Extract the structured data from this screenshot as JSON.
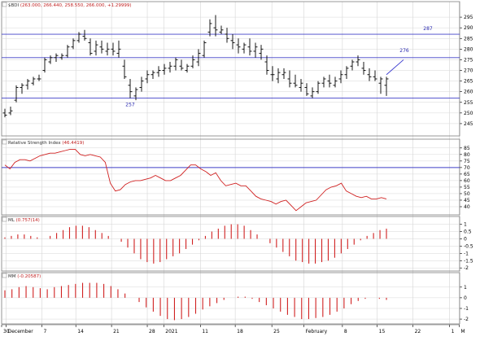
{
  "chart_data": {
    "type": "stock",
    "panels": [
      {
        "id": "price",
        "title_prefix": "$BDI",
        "title_values": "(263.000, 266.440, 258.550, 266.000, +1.29999)",
        "ylim": [
          240,
          300
        ],
        "yticks": [
          245,
          250,
          255,
          260,
          265,
          270,
          275,
          280,
          285,
          290,
          295
        ],
        "hlines": [
          {
            "value": 287,
            "label": "287"
          },
          {
            "value": 276,
            "label": "276"
          },
          {
            "value": 257,
            "label": "257"
          }
        ],
        "trendline": {
          "from": [
            67,
            268
          ],
          "to": [
            70,
            275
          ]
        },
        "ohlc": [
          [
            0,
            250,
            252,
            248,
            249
          ],
          [
            1,
            250,
            253,
            249,
            251
          ],
          [
            2,
            256,
            263,
            255,
            262
          ],
          [
            3,
            262,
            264,
            259,
            263
          ],
          [
            4,
            263,
            266,
            261,
            265
          ],
          [
            5,
            264,
            267,
            263,
            266
          ],
          [
            6,
            266,
            268,
            265,
            266
          ],
          [
            7,
            270,
            276,
            269,
            275
          ],
          [
            8,
            274,
            277,
            273,
            276
          ],
          [
            9,
            276,
            278,
            274,
            277
          ],
          [
            10,
            276,
            278,
            275,
            277
          ],
          [
            11,
            277,
            282,
            276,
            281
          ],
          [
            12,
            281,
            285,
            280,
            284
          ],
          [
            13,
            284,
            288,
            283,
            287
          ],
          [
            14,
            286,
            289,
            284,
            285
          ],
          [
            15,
            283,
            285,
            277,
            278
          ],
          [
            16,
            279,
            284,
            277,
            282
          ],
          [
            17,
            281,
            284,
            278,
            280
          ],
          [
            18,
            279,
            283,
            277,
            280
          ],
          [
            19,
            280,
            283,
            277,
            279
          ],
          [
            20,
            278,
            284,
            276,
            280
          ],
          [
            21,
            272,
            275,
            266,
            267
          ],
          [
            22,
            263,
            266,
            257,
            260
          ],
          [
            23,
            258,
            262,
            256,
            261
          ],
          [
            24,
            262,
            267,
            260,
            265
          ],
          [
            25,
            266,
            270,
            264,
            268
          ],
          [
            26,
            268,
            270,
            266,
            269
          ],
          [
            27,
            269,
            272,
            267,
            270
          ],
          [
            28,
            270,
            273,
            268,
            271
          ],
          [
            29,
            271,
            274,
            269,
            272
          ],
          [
            30,
            272,
            276,
            270,
            275
          ],
          [
            31,
            272,
            275,
            270,
            271
          ],
          [
            32,
            270,
            273,
            269,
            272
          ],
          [
            33,
            272,
            277,
            271,
            275
          ],
          [
            34,
            274,
            280,
            272,
            278
          ],
          [
            35,
            277,
            284,
            276,
            283
          ],
          [
            36,
            288,
            294,
            286,
            292
          ],
          [
            37,
            290,
            296,
            286,
            289
          ],
          [
            38,
            288,
            291,
            287,
            289
          ],
          [
            39,
            287,
            290,
            283,
            285
          ],
          [
            40,
            284,
            287,
            280,
            283
          ],
          [
            41,
            282,
            285,
            278,
            281
          ],
          [
            42,
            280,
            283,
            278,
            282
          ],
          [
            43,
            281,
            285,
            277,
            279
          ],
          [
            44,
            279,
            283,
            276,
            281
          ],
          [
            45,
            278,
            282,
            275,
            280
          ],
          [
            46,
            274,
            277,
            268,
            270
          ],
          [
            47,
            268,
            272,
            265,
            268
          ],
          [
            48,
            266,
            271,
            264,
            269
          ],
          [
            49,
            268,
            271,
            266,
            269
          ],
          [
            50,
            266,
            270,
            262,
            264
          ],
          [
            51,
            264,
            268,
            262,
            263
          ],
          [
            52,
            262,
            266,
            260,
            264
          ],
          [
            53,
            262,
            264,
            258,
            259
          ],
          [
            54,
            258,
            262,
            257,
            260
          ],
          [
            55,
            260,
            265,
            259,
            264
          ],
          [
            56,
            264,
            267,
            262,
            266
          ],
          [
            57,
            265,
            268,
            262,
            264
          ],
          [
            58,
            263,
            267,
            262,
            265
          ],
          [
            59,
            266,
            270,
            264,
            268
          ],
          [
            60,
            268,
            272,
            266,
            271
          ],
          [
            61,
            272,
            275,
            270,
            274
          ],
          [
            62,
            274,
            277,
            272,
            275
          ],
          [
            63,
            271,
            274,
            268,
            270
          ],
          [
            64,
            268,
            271,
            265,
            267
          ],
          [
            65,
            267,
            270,
            265,
            266
          ],
          [
            66,
            264,
            267,
            259,
            266
          ],
          [
            67,
            263,
            267,
            258,
            266
          ]
        ]
      },
      {
        "id": "rsi",
        "title_prefix": "Relative Strength Index",
        "title_values": "(46.4419)",
        "ylim": [
          35,
          88
        ],
        "yticks": [
          40,
          45,
          50,
          55,
          60,
          65,
          70,
          75,
          80,
          85
        ],
        "hlines": [
          {
            "value": 70
          }
        ],
        "values": [
          72,
          69,
          74,
          76,
          76,
          75,
          77,
          79,
          80,
          81,
          81,
          82,
          83,
          84,
          84,
          80,
          79,
          80,
          79,
          78,
          74,
          58,
          52,
          53,
          57,
          59,
          60,
          60,
          61,
          62,
          64,
          62,
          60,
          60,
          62,
          64,
          68,
          72,
          72,
          69,
          67,
          64,
          66,
          60,
          56,
          57,
          58,
          56,
          56,
          52,
          48,
          46,
          45,
          44,
          42,
          44,
          45,
          41,
          37,
          40,
          43,
          44,
          45,
          49,
          53,
          55,
          56,
          58,
          52,
          50,
          48,
          47,
          48,
          46,
          46,
          47,
          46
        ]
      },
      {
        "id": "ml",
        "title_prefix": "ML",
        "title_values": "(0.757(14)",
        "ylim": [
          -2.1,
          1.2
        ],
        "yticks": [
          1.0,
          0.5,
          0.0,
          -0.5,
          -1.0,
          -1.5,
          -2.0
        ],
        "hlines": [],
        "values": [
          0.1,
          0.2,
          0.3,
          0.3,
          0.2,
          0.1,
          0.0,
          0.2,
          0.4,
          0.6,
          0.8,
          0.9,
          0.9,
          0.8,
          0.6,
          0.4,
          0.2,
          0.0,
          -0.2,
          -0.6,
          -1.0,
          -1.4,
          -1.6,
          -1.7,
          -1.6,
          -1.4,
          -1.2,
          -1.0,
          -0.7,
          -0.4,
          -0.1,
          0.2,
          0.5,
          0.7,
          0.9,
          1.0,
          1.0,
          0.9,
          0.6,
          0.3,
          0.0,
          -0.3,
          -0.6,
          -0.9,
          -1.2,
          -1.5,
          -1.6,
          -1.7,
          -1.7,
          -1.6,
          -1.5,
          -1.3,
          -1.0,
          -0.7,
          -0.4,
          -0.1,
          0.2,
          0.4,
          0.6,
          0.7
        ]
      },
      {
        "id": "mm",
        "title_prefix": "MM",
        "title_values": "(-0.20587)",
        "ylim": [
          -2.3,
          1.9
        ],
        "yticks": [
          1,
          0,
          -1,
          -2
        ],
        "hlines": [],
        "values": [
          0.7,
          0.8,
          1.0,
          1.1,
          1.0,
          0.9,
          0.8,
          1.0,
          1.1,
          1.2,
          1.3,
          1.4,
          1.4,
          1.4,
          1.3,
          1.1,
          0.8,
          0.4,
          0.0,
          -0.4,
          -0.9,
          -1.3,
          -1.7,
          -2.0,
          -2.1,
          -2.0,
          -1.8,
          -1.5,
          -1.1,
          -0.8,
          -0.5,
          -0.2,
          0.0,
          0.1,
          0.1,
          -0.1,
          -0.4,
          -0.7,
          -1.0,
          -1.3,
          -1.6,
          -1.8,
          -2.0,
          -2.0,
          -1.9,
          -1.8,
          -1.6,
          -1.3,
          -1.0,
          -0.6,
          -0.3,
          -0.1,
          0.0,
          -0.1,
          -0.2
        ]
      }
    ],
    "xaxis": {
      "labels": [
        {
          "text": "30",
          "t": 0.0
        },
        {
          "text": "December",
          "t": 0.01
        },
        {
          "text": "7",
          "t": 0.088
        },
        {
          "text": "14",
          "t": 0.162
        },
        {
          "text": "21",
          "t": 0.24
        },
        {
          "text": "28",
          "t": 0.318
        },
        {
          "text": "2021",
          "t": 0.354
        },
        {
          "text": "11",
          "t": 0.434
        },
        {
          "text": "18",
          "t": 0.51
        },
        {
          "text": "25",
          "t": 0.59
        },
        {
          "text": "February",
          "t": 0.66
        },
        {
          "text": "8",
          "t": 0.744
        },
        {
          "text": "15",
          "t": 0.82
        },
        {
          "text": "22",
          "t": 0.898
        },
        {
          "text": "1",
          "t": 0.978
        },
        {
          "text": "M",
          "t": 0.999
        }
      ]
    },
    "colors": {
      "price": "#000000",
      "trendline": "#3a3ad0",
      "hline": "#4040c8",
      "rsi": "#d02020",
      "bars": "#d02020",
      "grid": "#d6d6d6",
      "frame": "#808080"
    }
  }
}
